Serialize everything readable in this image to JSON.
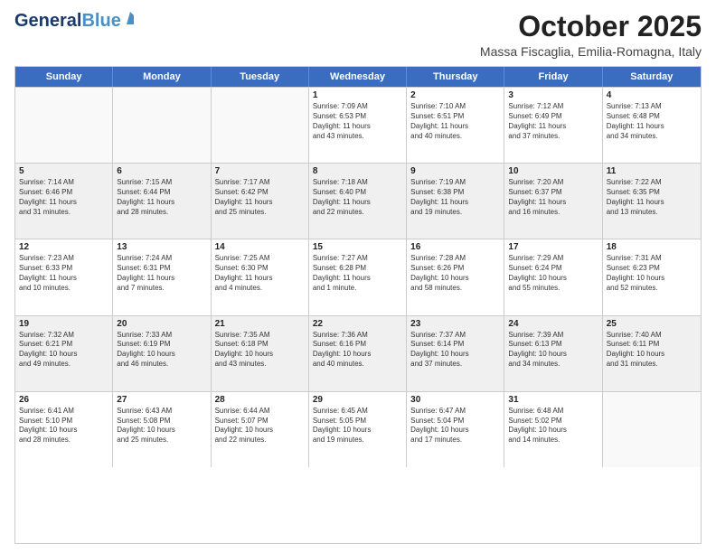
{
  "logo": {
    "line1": "General",
    "line2": "Blue"
  },
  "header": {
    "month": "October 2025",
    "location": "Massa Fiscaglia, Emilia-Romagna, Italy"
  },
  "weekdays": [
    "Sunday",
    "Monday",
    "Tuesday",
    "Wednesday",
    "Thursday",
    "Friday",
    "Saturday"
  ],
  "weeks": [
    [
      {
        "day": "",
        "info": ""
      },
      {
        "day": "",
        "info": ""
      },
      {
        "day": "",
        "info": ""
      },
      {
        "day": "1",
        "info": "Sunrise: 7:09 AM\nSunset: 6:53 PM\nDaylight: 11 hours\nand 43 minutes."
      },
      {
        "day": "2",
        "info": "Sunrise: 7:10 AM\nSunset: 6:51 PM\nDaylight: 11 hours\nand 40 minutes."
      },
      {
        "day": "3",
        "info": "Sunrise: 7:12 AM\nSunset: 6:49 PM\nDaylight: 11 hours\nand 37 minutes."
      },
      {
        "day": "4",
        "info": "Sunrise: 7:13 AM\nSunset: 6:48 PM\nDaylight: 11 hours\nand 34 minutes."
      }
    ],
    [
      {
        "day": "5",
        "info": "Sunrise: 7:14 AM\nSunset: 6:46 PM\nDaylight: 11 hours\nand 31 minutes."
      },
      {
        "day": "6",
        "info": "Sunrise: 7:15 AM\nSunset: 6:44 PM\nDaylight: 11 hours\nand 28 minutes."
      },
      {
        "day": "7",
        "info": "Sunrise: 7:17 AM\nSunset: 6:42 PM\nDaylight: 11 hours\nand 25 minutes."
      },
      {
        "day": "8",
        "info": "Sunrise: 7:18 AM\nSunset: 6:40 PM\nDaylight: 11 hours\nand 22 minutes."
      },
      {
        "day": "9",
        "info": "Sunrise: 7:19 AM\nSunset: 6:38 PM\nDaylight: 11 hours\nand 19 minutes."
      },
      {
        "day": "10",
        "info": "Sunrise: 7:20 AM\nSunset: 6:37 PM\nDaylight: 11 hours\nand 16 minutes."
      },
      {
        "day": "11",
        "info": "Sunrise: 7:22 AM\nSunset: 6:35 PM\nDaylight: 11 hours\nand 13 minutes."
      }
    ],
    [
      {
        "day": "12",
        "info": "Sunrise: 7:23 AM\nSunset: 6:33 PM\nDaylight: 11 hours\nand 10 minutes."
      },
      {
        "day": "13",
        "info": "Sunrise: 7:24 AM\nSunset: 6:31 PM\nDaylight: 11 hours\nand 7 minutes."
      },
      {
        "day": "14",
        "info": "Sunrise: 7:25 AM\nSunset: 6:30 PM\nDaylight: 11 hours\nand 4 minutes."
      },
      {
        "day": "15",
        "info": "Sunrise: 7:27 AM\nSunset: 6:28 PM\nDaylight: 11 hours\nand 1 minute."
      },
      {
        "day": "16",
        "info": "Sunrise: 7:28 AM\nSunset: 6:26 PM\nDaylight: 10 hours\nand 58 minutes."
      },
      {
        "day": "17",
        "info": "Sunrise: 7:29 AM\nSunset: 6:24 PM\nDaylight: 10 hours\nand 55 minutes."
      },
      {
        "day": "18",
        "info": "Sunrise: 7:31 AM\nSunset: 6:23 PM\nDaylight: 10 hours\nand 52 minutes."
      }
    ],
    [
      {
        "day": "19",
        "info": "Sunrise: 7:32 AM\nSunset: 6:21 PM\nDaylight: 10 hours\nand 49 minutes."
      },
      {
        "day": "20",
        "info": "Sunrise: 7:33 AM\nSunset: 6:19 PM\nDaylight: 10 hours\nand 46 minutes."
      },
      {
        "day": "21",
        "info": "Sunrise: 7:35 AM\nSunset: 6:18 PM\nDaylight: 10 hours\nand 43 minutes."
      },
      {
        "day": "22",
        "info": "Sunrise: 7:36 AM\nSunset: 6:16 PM\nDaylight: 10 hours\nand 40 minutes."
      },
      {
        "day": "23",
        "info": "Sunrise: 7:37 AM\nSunset: 6:14 PM\nDaylight: 10 hours\nand 37 minutes."
      },
      {
        "day": "24",
        "info": "Sunrise: 7:39 AM\nSunset: 6:13 PM\nDaylight: 10 hours\nand 34 minutes."
      },
      {
        "day": "25",
        "info": "Sunrise: 7:40 AM\nSunset: 6:11 PM\nDaylight: 10 hours\nand 31 minutes."
      }
    ],
    [
      {
        "day": "26",
        "info": "Sunrise: 6:41 AM\nSunset: 5:10 PM\nDaylight: 10 hours\nand 28 minutes."
      },
      {
        "day": "27",
        "info": "Sunrise: 6:43 AM\nSunset: 5:08 PM\nDaylight: 10 hours\nand 25 minutes."
      },
      {
        "day": "28",
        "info": "Sunrise: 6:44 AM\nSunset: 5:07 PM\nDaylight: 10 hours\nand 22 minutes."
      },
      {
        "day": "29",
        "info": "Sunrise: 6:45 AM\nSunset: 5:05 PM\nDaylight: 10 hours\nand 19 minutes."
      },
      {
        "day": "30",
        "info": "Sunrise: 6:47 AM\nSunset: 5:04 PM\nDaylight: 10 hours\nand 17 minutes."
      },
      {
        "day": "31",
        "info": "Sunrise: 6:48 AM\nSunset: 5:02 PM\nDaylight: 10 hours\nand 14 minutes."
      },
      {
        "day": "",
        "info": ""
      }
    ]
  ]
}
